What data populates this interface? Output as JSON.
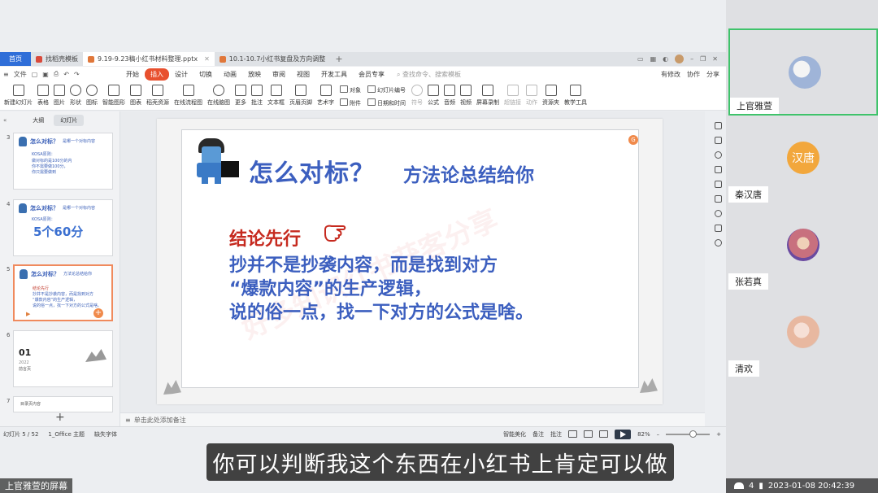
{
  "tabs": {
    "home": "首页",
    "items": [
      {
        "label": "找稻壳模板",
        "color": "#d94a3b",
        "active": false
      },
      {
        "label": "9.19-9.23稿小红书材料整理.pptx",
        "color": "#e0773a",
        "active": true
      },
      {
        "label": "10.1-10.7小红书复盘及方向调整",
        "color": "#e0773a",
        "active": false
      }
    ]
  },
  "menubar": {
    "file": "文件",
    "items": [
      "开始",
      "插入",
      "设计",
      "切换",
      "动画",
      "放映",
      "审阅",
      "视图",
      "开发工具",
      "会员专享"
    ],
    "active": "插入",
    "search": "查找命令、搜索模板",
    "right": [
      "有修改",
      "协作",
      "分享"
    ]
  },
  "ribbon": {
    "buttons": [
      {
        "label": "新建幻灯片"
      },
      {
        "label": "表格"
      },
      {
        "label": "图片"
      },
      {
        "label": "形状"
      },
      {
        "label": "图标"
      },
      {
        "label": "智能图形"
      },
      {
        "label": "图表"
      },
      {
        "label": "稻壳资源"
      },
      {
        "label": "在线流程图"
      },
      {
        "label": "在线脑图"
      },
      {
        "label": "更多"
      },
      {
        "label": "批注"
      },
      {
        "label": "文本框"
      },
      {
        "label": "页眉页脚"
      },
      {
        "label": "艺术字"
      }
    ],
    "stack1": [
      "对象",
      "附件"
    ],
    "stack2": [
      "幻灯片编号",
      "日期和时间"
    ],
    "buttons2": [
      {
        "label": "符号",
        "disabled": true
      },
      {
        "label": "公式",
        "disabled": false
      },
      {
        "label": "音频",
        "disabled": false
      },
      {
        "label": "视频",
        "disabled": false
      },
      {
        "label": "屏幕录制",
        "disabled": false
      },
      {
        "label": "超链接",
        "disabled": true
      },
      {
        "label": "动作",
        "disabled": true
      },
      {
        "label": "资源夹",
        "disabled": false
      },
      {
        "label": "教学工具",
        "disabled": false
      }
    ]
  },
  "leftpanel": {
    "tab_outline": "大纲",
    "tab_slides": "幻灯片",
    "thumbs": [
      {
        "num": "3",
        "title": "怎么对标？",
        "sub": "是哪一个对标内容",
        "lines": [
          "KOSA原则：",
          "做对标的是100分的内",
          "你不需要做100分，",
          "你只需要做到"
        ],
        "big": ""
      },
      {
        "num": "4",
        "title": "怎么对标？",
        "sub": "是哪一个对标内容",
        "lines": [
          "KOSA原则："
        ],
        "big": "5个60分"
      },
      {
        "num": "5",
        "title": "怎么对标？",
        "sub": "方法论总结给你",
        "lines": [
          "结论先行",
          "抄并不是抄袭内容，而是找到对方",
          "“爆款内容”的生产逻辑，",
          "说的俗一点，找一下对方的公式是啥。"
        ],
        "big": ""
      },
      {
        "num": "6",
        "title": "",
        "sub": "",
        "lines": [
          "2022",
          "前言页"
        ],
        "big": "01"
      },
      {
        "num": "7",
        "title": "",
        "sub": "",
        "lines": [
          "目录页内容"
        ],
        "big": ""
      }
    ]
  },
  "slide": {
    "title": "怎么对标？",
    "subtitle": "方法论总结给你",
    "red_heading": "结论先行",
    "body": [
      "抄并不是抄袭内容，而是找到对方",
      "“爆款内容”的生产逻辑，",
      "说的俗一点，找一下对方的公式是啥。"
    ],
    "watermark": "好多知识红书获客分享",
    "badge": "G"
  },
  "notes_placeholder": "单击此处添加备注",
  "statusbar": {
    "slide_count": "幻灯片 5 / 52",
    "theme": "1_Office 主题",
    "font_missing": "缺失字体",
    "smart": "智能美化",
    "notes": "备注",
    "comment": "批注",
    "zoom": "82%",
    "zoom_fraction": 0.6
  },
  "caption": "你可以判断我这个东西在小红书上肯定可以做",
  "screen_owner": "上官雅萱的屏幕",
  "participants": [
    {
      "name": "上官雅萱",
      "avatar_text": "",
      "avatar_color": "#9fb4d8",
      "active": true
    },
    {
      "name": "秦汉唐",
      "avatar_text": "汉唐",
      "avatar_color": "#f2a73c",
      "active": false
    },
    {
      "name": "张若真",
      "avatar_text": "",
      "avatar_color": "#c8707e",
      "active": false
    },
    {
      "name": "清欢",
      "avatar_text": "",
      "avatar_color": "#e8b8a0",
      "active": false
    }
  ],
  "participant_count": "4",
  "timestamp": "2023-01-08 20:42:39"
}
